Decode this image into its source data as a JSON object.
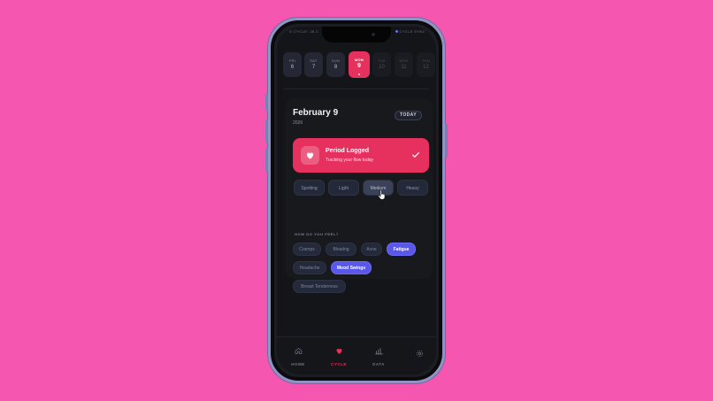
{
  "status": {
    "left": "O CYCLE: 28 C",
    "right": "CYCLE SYNC",
    "tv": "tv"
  },
  "days": [
    {
      "name": "FRI",
      "date": "6"
    },
    {
      "name": "SAT",
      "date": "7"
    },
    {
      "name": "SUN",
      "date": "8"
    },
    {
      "name": "MON",
      "date": "9"
    },
    {
      "name": "TUE",
      "date": "10"
    },
    {
      "name": "WED",
      "date": "11"
    },
    {
      "name": "THU",
      "date": "12"
    }
  ],
  "header": {
    "date_title": "February 9",
    "year": "2026",
    "today_label": "TODAY"
  },
  "period_card": {
    "title": "Period Logged",
    "subtitle": "Tracking your flow today"
  },
  "flow_options": [
    "Spotting",
    "Light",
    "Medium",
    "Heavy"
  ],
  "feel": {
    "heading": "HOW DO YOU FEEL?",
    "symptoms": [
      "Cramps",
      "Bloating",
      "Acne",
      "Fatigue",
      "Headache",
      "Mood Swings",
      "Breast Tenderness"
    ],
    "selected": [
      "Fatigue",
      "Mood Swings"
    ]
  },
  "tabs": [
    {
      "label": "HOME",
      "icon": "home-icon"
    },
    {
      "label": "CYCLE",
      "icon": "heart-icon"
    },
    {
      "label": "DATA",
      "icon": "bar-chart-icon"
    },
    {
      "label": "",
      "icon": "gear-icon"
    }
  ],
  "colors": {
    "background": "#f456b0",
    "accent": "#e6315f",
    "selected_chip": "#5a58e8",
    "screen": "#141518"
  }
}
